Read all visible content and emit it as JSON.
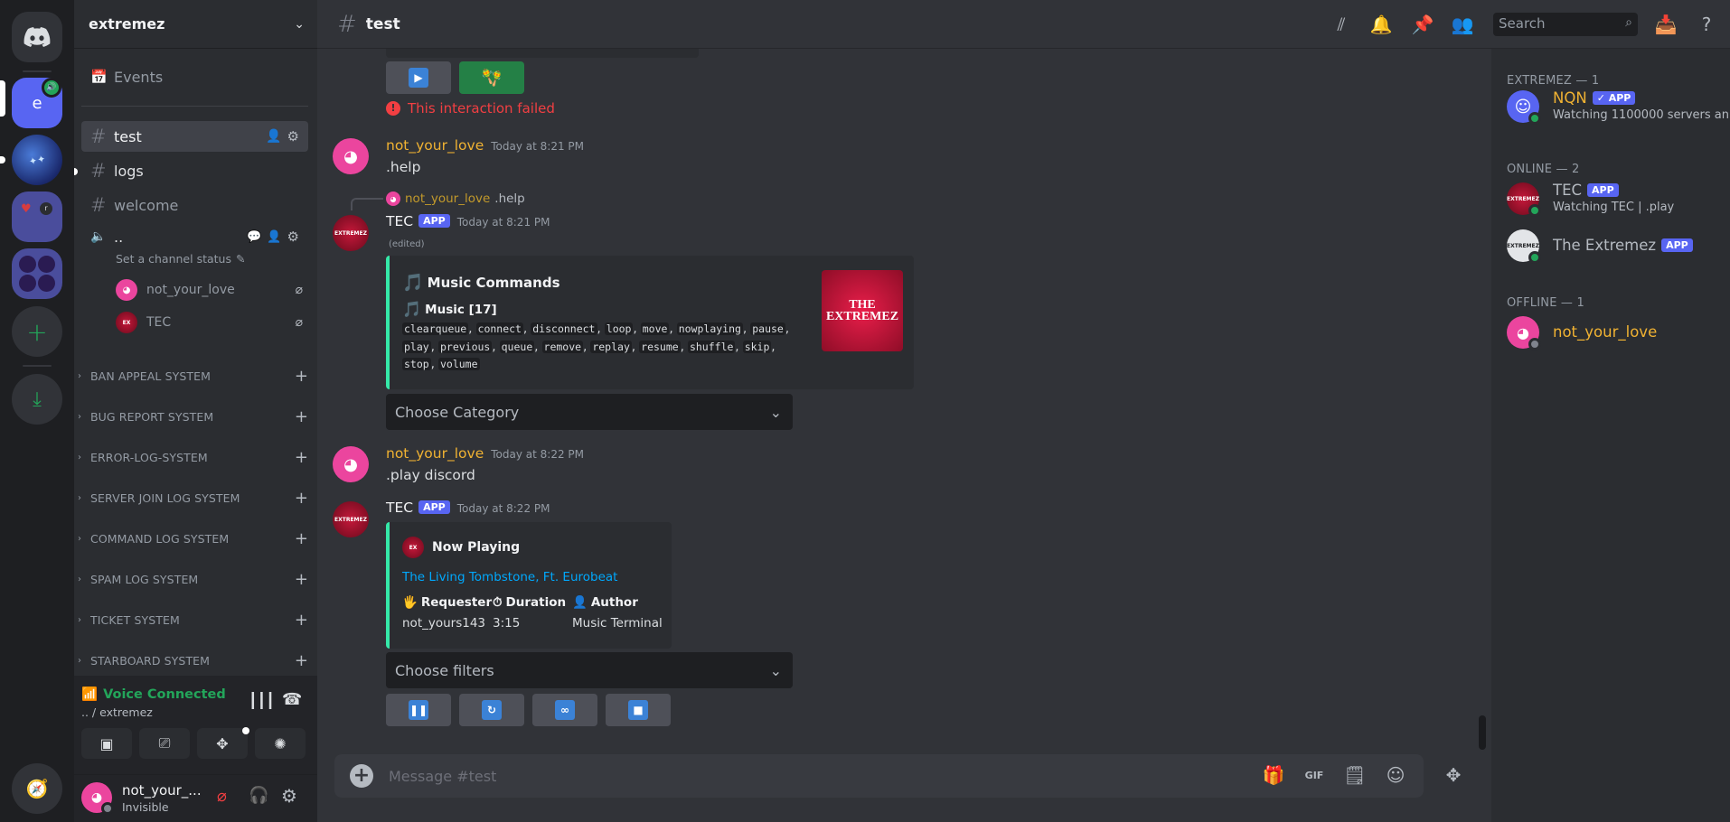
{
  "guild": {
    "name": "extremez"
  },
  "rail": {
    "active_letter": "e",
    "server3_letter": "r"
  },
  "sidebar": {
    "events_label": "Events",
    "channels": [
      {
        "name": "test"
      },
      {
        "name": "logs"
      },
      {
        "name": "welcome"
      }
    ],
    "voice_channel": {
      "name": "..",
      "status": "Set a channel status",
      "users": [
        "not_your_love",
        "TEC"
      ]
    },
    "categories": [
      "BAN APPEAL SYSTEM",
      "BUG REPORT SYSTEM",
      "ERROR-LOG-SYSTEM",
      "SERVER JOIN LOG SYSTEM",
      "COMMAND LOG SYSTEM",
      "SPAM LOG SYSTEM",
      "TICKET SYSTEM",
      "STARBOARD SYSTEM"
    ]
  },
  "voice_panel": {
    "title": "Voice Connected",
    "subtitle": ".. / extremez"
  },
  "user_panel": {
    "name": "not_your_...",
    "status": "Invisible"
  },
  "header": {
    "channel": "test",
    "search_placeholder": "Search"
  },
  "messages": {
    "failed": "This interaction failed",
    "m1": {
      "author": "not_your_love",
      "time": "Today at 8:21 PM",
      "text": ".help"
    },
    "reply": {
      "author": "not_your_love",
      "text": ".help"
    },
    "m2": {
      "author": "TEC",
      "badge": "APP",
      "time": "Today at 8:21 PM",
      "edited": "(edited)",
      "embed_title": "Music Commands",
      "embed_field": "Music [17]",
      "commands": [
        "clearqueue",
        "connect",
        "disconnect",
        "loop",
        "move",
        "nowplaying",
        "pause",
        "play",
        "previous",
        "queue",
        "remove",
        "replay",
        "resume",
        "shuffle",
        "skip",
        "stop",
        "volume"
      ],
      "thumb_text": "THE EXTREMEZ",
      "select": "Choose Category"
    },
    "m3": {
      "author": "not_your_love",
      "time": "Today at 8:22 PM",
      "text": ".play discord"
    },
    "m4": {
      "author": "TEC",
      "badge": "APP",
      "time": "Today at 8:22 PM",
      "np_title": "Now Playing",
      "track": "The Living Tombstone, Ft. Eurobeat",
      "fields": [
        {
          "label": "Requester",
          "value": "not_yours143"
        },
        {
          "label": "Duration",
          "value": "3:15"
        },
        {
          "label": "Author",
          "value": "Music Terminal"
        }
      ],
      "select": "Choose filters"
    }
  },
  "input": {
    "placeholder": "Message #test"
  },
  "members": {
    "groups": [
      {
        "title": "EXTREMEZ — 1"
      },
      {
        "title": "ONLINE — 2"
      },
      {
        "title": "OFFLINE — 1"
      }
    ],
    "nqn": {
      "name": "NQN",
      "badge": "✓ APP",
      "activity": "Watching 1100000 servers an..."
    },
    "tec": {
      "name": "TEC",
      "badge": "APP",
      "activity": "Watching TEC | .play"
    },
    "extremez": {
      "name": "The Extremez",
      "badge": "APP"
    },
    "offline_user": {
      "name": "not_your_love"
    }
  },
  "colors": {
    "accent": "#5865f2",
    "pink": "#eb459e",
    "username_yellow": "#f0b232",
    "green": "#23a55a",
    "embed_bar": "#35e8a8",
    "link": "#00a8fc",
    "error": "#f23f42"
  }
}
